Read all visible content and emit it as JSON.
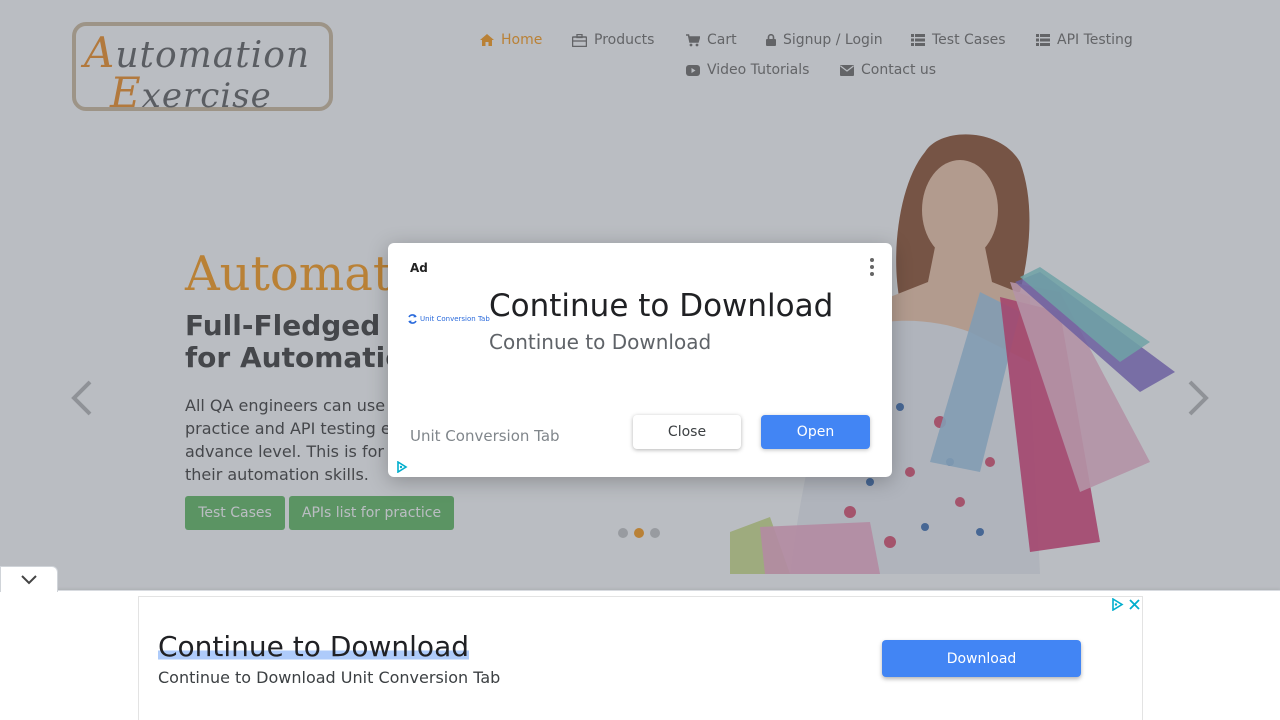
{
  "logo": {
    "line1_cap": "A",
    "line1_rest": "utomation",
    "line2_cap": "E",
    "line2_rest": "xercise"
  },
  "nav": [
    {
      "label": "Home",
      "icon": "home-icon",
      "active": true
    },
    {
      "label": "Products",
      "icon": "briefcase-icon"
    },
    {
      "label": "Cart",
      "icon": "cart-icon"
    },
    {
      "label": "Signup / Login",
      "icon": "lock-icon"
    },
    {
      "label": "Test Cases",
      "icon": "list-icon"
    },
    {
      "label": "API Testing",
      "icon": "list-icon"
    },
    {
      "label": "Video Tutorials",
      "icon": "youtube-play-icon"
    },
    {
      "label": "Contact us",
      "icon": "envelope-icon"
    }
  ],
  "hero": {
    "title": "Automat",
    "subtitle_line1": "Full-Fledged",
    "subtitle_line2": "for Automatic",
    "text_lines": [
      "All QA engineers can use",
      "practice and API testing e",
      "advance level. This is for",
      "their automation skills."
    ],
    "btn_test_cases": "Test Cases",
    "btn_apis": "APIs list for practice",
    "active_slide": 2,
    "slide_count": 3
  },
  "modal_ad": {
    "ad_label": "Ad",
    "logo_text": "Unit Conversion Tab",
    "title": "Continue to Download",
    "subtitle": "Continue to Download",
    "advertiser": "Unit Conversion Tab",
    "close_label": "Close",
    "open_label": "Open"
  },
  "anchor_ad": {
    "title": "Continue to Download",
    "subtitle": "Continue to Download Unit Conversion Tab",
    "download_label": "Download"
  },
  "colors": {
    "accent": "#fe980f",
    "green": "#5cb85c",
    "ad_blue": "#4285f4"
  }
}
